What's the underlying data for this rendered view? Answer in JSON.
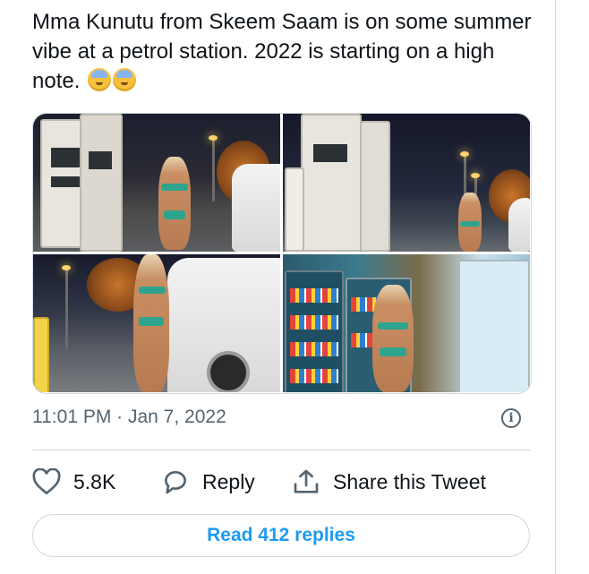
{
  "tweet": {
    "text": "Mma Kunutu from Skeem Saam is on some summer vibe at a petrol station. 2022 is starting on a high note.",
    "emojis": [
      "cold-face-emoji",
      "cold-face-emoji"
    ],
    "timestamp": "11:01 PM · Jan 7, 2022"
  },
  "media": {
    "photos": [
      {
        "name": "photo-petrol-pump-night"
      },
      {
        "name": "photo-pump-side-view"
      },
      {
        "name": "photo-fueling-van"
      },
      {
        "name": "photo-convenience-store-fridge"
      }
    ]
  },
  "actions": {
    "like_count": "5.8K",
    "reply_label": "Reply",
    "share_label": "Share this Tweet"
  },
  "footer": {
    "read_replies_label": "Read 412 replies"
  },
  "colors": {
    "accent": "#1d9bf0",
    "secondary_text": "#536471",
    "border": "#cfd9de"
  }
}
